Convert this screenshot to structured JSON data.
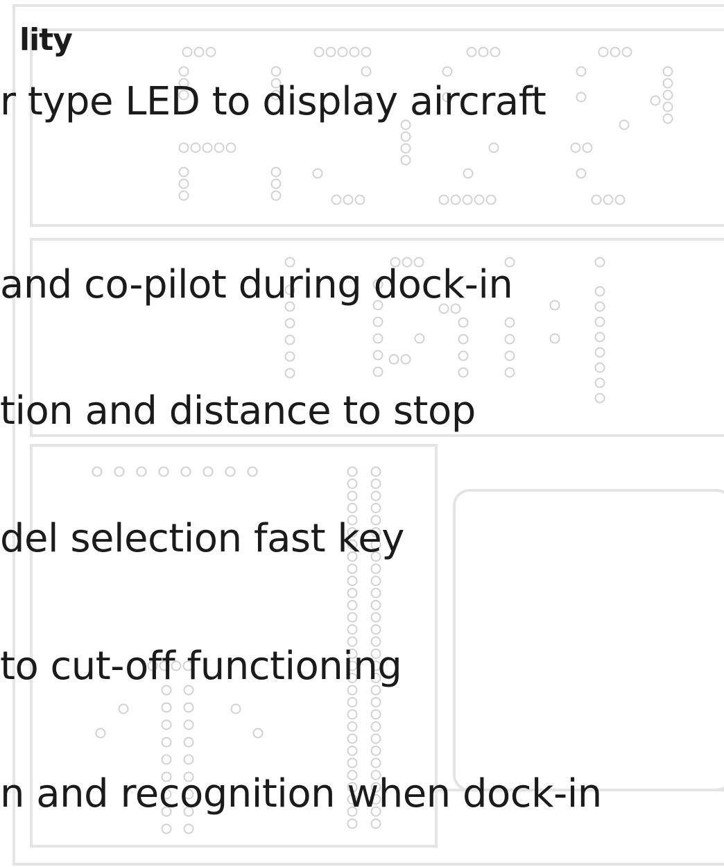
{
  "heading": "lity",
  "lines": [
    "r type LED to display aircraft",
    "and co-pilot during dock-in",
    "tion and distance to stop",
    "del selection fast key",
    " to cut-off functioning",
    "n and recognition when dock-in"
  ],
  "colors": {
    "text": "#1b1b1b",
    "frame": "#e4e4e4",
    "led_dot": "#d2d2d2"
  }
}
